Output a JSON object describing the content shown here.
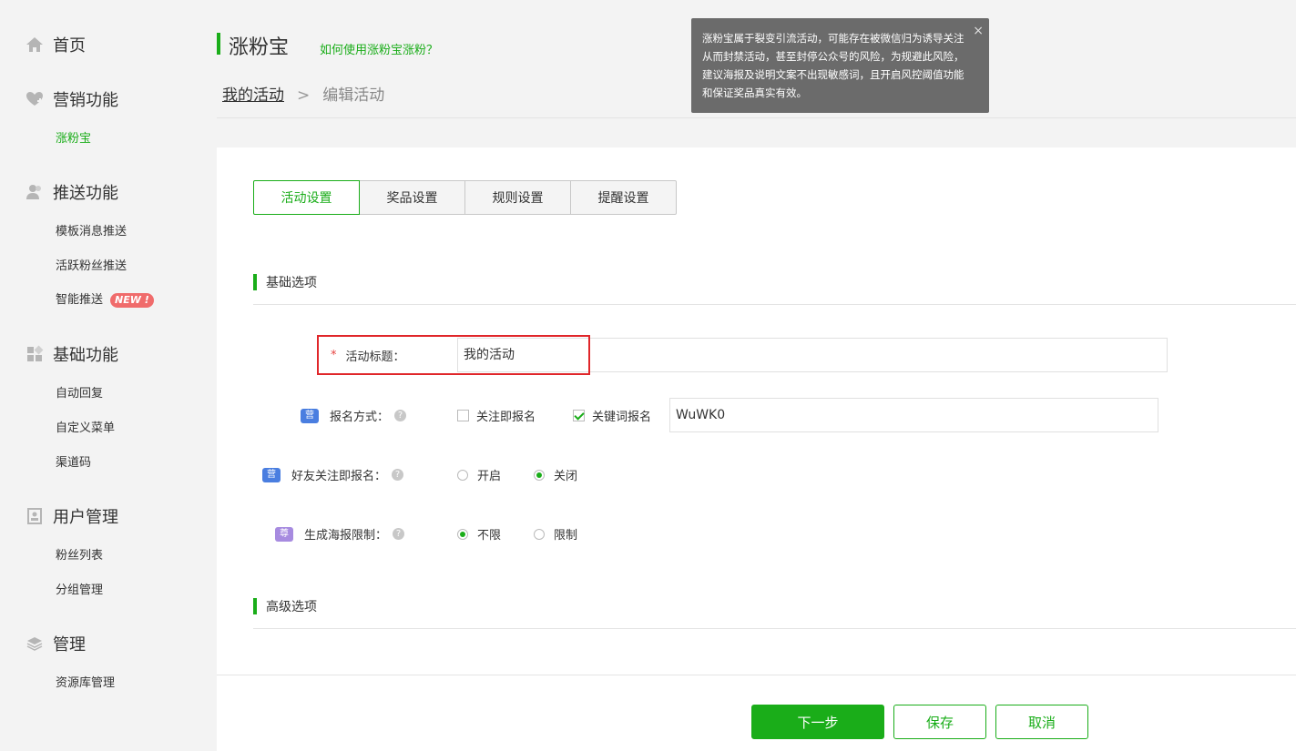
{
  "sidebar": {
    "home": {
      "label": "首页",
      "icon": "home-icon"
    },
    "groups": [
      {
        "label": "营销功能",
        "icon": "heart-plus-icon",
        "items": [
          {
            "label": "涨粉宝",
            "active": true
          }
        ]
      },
      {
        "label": "推送功能",
        "icon": "users-icon",
        "items": [
          {
            "label": "模板消息推送"
          },
          {
            "label": "活跃粉丝推送"
          },
          {
            "label": "智能推送",
            "badge": "NEW !"
          }
        ]
      },
      {
        "label": "基础功能",
        "icon": "grid-icon",
        "items": [
          {
            "label": "自动回复"
          },
          {
            "label": "自定义菜单"
          },
          {
            "label": "渠道码"
          }
        ]
      },
      {
        "label": "用户管理",
        "icon": "user-card-icon",
        "items": [
          {
            "label": "粉丝列表"
          },
          {
            "label": "分组管理"
          }
        ]
      },
      {
        "label": "管理",
        "icon": "layers-icon",
        "items": [
          {
            "label": "资源库管理"
          }
        ]
      }
    ]
  },
  "header": {
    "title": "涨粉宝",
    "help_link": "如何使用涨粉宝涨粉？",
    "breadcrumb": {
      "root": "我的活动",
      "separator": ">",
      "current": "编辑活动"
    }
  },
  "tooltip": {
    "text": "涨粉宝属于裂变引流活动，可能存在被微信归为诱导关注从而封禁活动，甚至封停公众号的风险，为规避此风险，建议海报及说明文案不出现敏感词，且开启风控阈值功能和保证奖品真实有效。",
    "close": "×"
  },
  "tabs": [
    {
      "label": "活动设置",
      "active": true
    },
    {
      "label": "奖品设置"
    },
    {
      "label": "规则设置"
    },
    {
      "label": "提醒设置"
    }
  ],
  "sections": {
    "basic": "基础选项",
    "advanced": "高级选项"
  },
  "form": {
    "title_label": "活动标题：",
    "required_mark": "*",
    "title_value": "我的活动",
    "signup": {
      "tag": "营",
      "label": "报名方式：",
      "options": [
        {
          "label": "关注即报名",
          "checked": false
        },
        {
          "label": "关键词报名",
          "checked": true
        }
      ],
      "keyword_value": "WuWK0"
    },
    "friend_follow": {
      "tag": "营",
      "label": "好友关注即报名：",
      "options": [
        {
          "label": "开启",
          "checked": false
        },
        {
          "label": "关闭",
          "checked": true
        }
      ]
    },
    "poster_limit": {
      "tag": "尊",
      "label": "生成海报限制：",
      "options": [
        {
          "label": "不限",
          "checked": true
        },
        {
          "label": "限制",
          "checked": false
        }
      ]
    },
    "help_glyph": "?"
  },
  "footer": {
    "next": "下一步",
    "save": "保存",
    "cancel": "取消"
  },
  "colors": {
    "accent": "#1aad19",
    "highlight": "#e0262a",
    "tag_blue": "#4a7ee0",
    "tag_purple": "#a78be0"
  }
}
